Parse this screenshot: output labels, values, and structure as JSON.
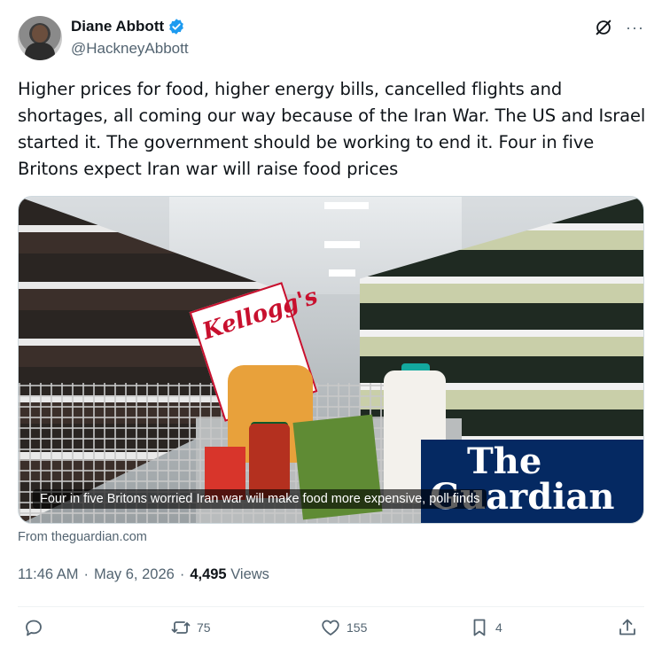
{
  "author": {
    "display_name": "Diane Abbott",
    "handle": "@HackneyAbbott",
    "verified_icon": "verified-badge-icon",
    "avatar_icon": "avatar"
  },
  "header_icons": [
    "grok-icon",
    "more-options-icon"
  ],
  "more_label": "···",
  "tweet": {
    "text": "Higher prices for food, higher energy bills, cancelled flights and shortages, all coming our way because of the Iran War. The US and Israel started it. The government should be working to end it. Four in five Britons expect Iran war will raise food prices"
  },
  "link_card": {
    "caption": "Four in five Britons worried Iran war will make food more expensive, poll finds",
    "brand_the": "The",
    "brand_name": "Guardian",
    "kellogs_word": "Kellogg's",
    "source": "From theguardian.com"
  },
  "meta": {
    "time": "11:46 AM",
    "sep1": "·",
    "date": "May 6, 2026",
    "sep2": "·",
    "views_count": "4,495",
    "views_label": "Views"
  },
  "actions": {
    "reply": {
      "icon": "reply-icon",
      "count": ""
    },
    "retweet": {
      "icon": "retweet-icon",
      "count": "75"
    },
    "like": {
      "icon": "heart-icon",
      "count": "155"
    },
    "bookmark": {
      "icon": "bookmark-icon",
      "count": "4"
    },
    "share": {
      "icon": "share-icon",
      "count": ""
    }
  },
  "colors": {
    "text_primary": "#0f1419",
    "text_secondary": "#536471",
    "verified_blue": "#1d9bf0",
    "guardian_navy": "#052962"
  }
}
